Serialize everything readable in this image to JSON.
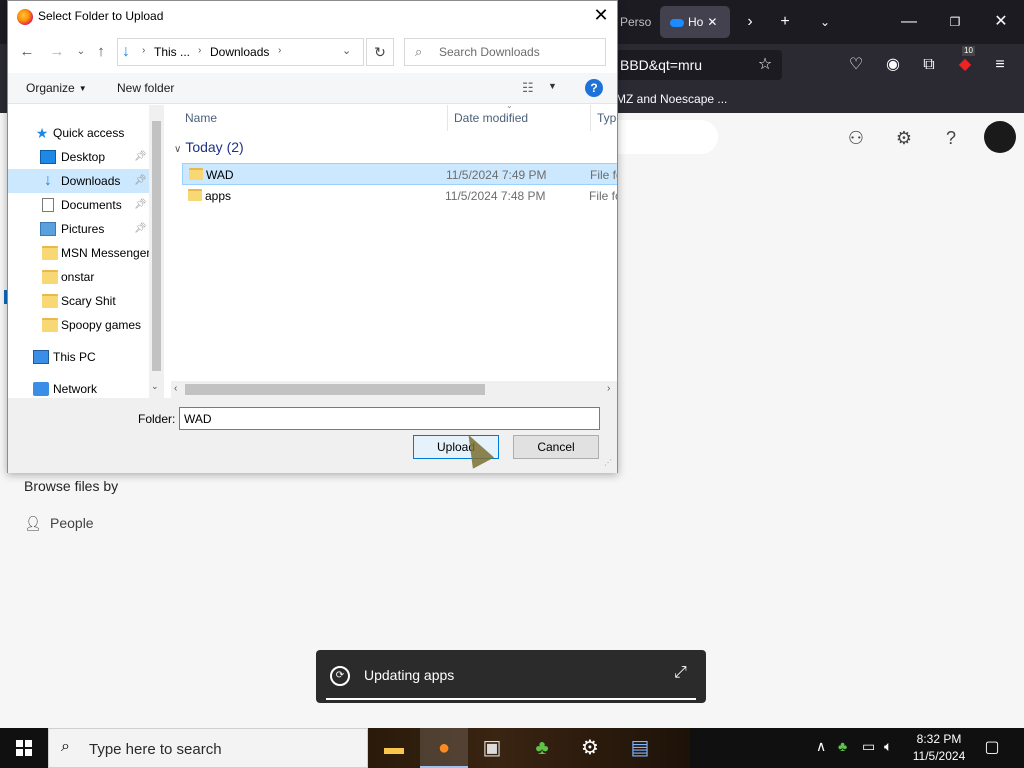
{
  "browser": {
    "tabs": [
      {
        "label": "Perso",
        "active": false
      },
      {
        "label": "Ho",
        "active": true
      }
    ],
    "url_fragment": "BBD&qt=mru",
    "bookmark_label": "MZ and Noescape ...",
    "extension_badge": "10"
  },
  "onedrive": {
    "browse_title": "Browse files by",
    "people_label": "People"
  },
  "dialog": {
    "title": "Select Folder to Upload",
    "close_glyph": "✕",
    "breadcrumb": [
      "This ...",
      "Downloads"
    ],
    "search_placeholder": "Search Downloads",
    "toolbar": {
      "organize": "Organize",
      "new_folder": "New folder"
    },
    "nav_items": [
      {
        "label": "Quick access",
        "icon": "star-icon",
        "pinned": false,
        "selected": false
      },
      {
        "label": "Desktop",
        "icon": "desktop-icon",
        "pinned": true,
        "selected": false
      },
      {
        "label": "Downloads",
        "icon": "download-arrow-icon",
        "pinned": true,
        "selected": true
      },
      {
        "label": "Documents",
        "icon": "document-icon",
        "pinned": true,
        "selected": false
      },
      {
        "label": "Pictures",
        "icon": "pictures-icon",
        "pinned": true,
        "selected": false
      },
      {
        "label": "MSN Messenger",
        "icon": "folder-icon",
        "pinned": false,
        "selected": false
      },
      {
        "label": "onstar",
        "icon": "folder-icon",
        "pinned": false,
        "selected": false
      },
      {
        "label": "Scary Shit",
        "icon": "folder-icon",
        "pinned": false,
        "selected": false
      },
      {
        "label": "Spoopy games",
        "icon": "folder-icon",
        "pinned": false,
        "selected": false
      },
      {
        "label": "This PC",
        "icon": "computer-icon",
        "pinned": false,
        "selected": false
      },
      {
        "label": "Network",
        "icon": "network-icon",
        "pinned": false,
        "selected": false
      }
    ],
    "columns": [
      "Name",
      "Date modified",
      "Type"
    ],
    "group_label": "Today (2)",
    "files": [
      {
        "name": "WAD",
        "date": "11/5/2024 7:49 PM",
        "type": "File fo",
        "selected": true
      },
      {
        "name": "apps",
        "date": "11/5/2024 7:48 PM",
        "type": "File fo",
        "selected": false
      }
    ],
    "folder_label": "Folder:",
    "folder_value": "WAD",
    "upload_label": "Upload",
    "cancel_label": "Cancel"
  },
  "toast": {
    "text": "Updating apps"
  },
  "taskbar": {
    "search_placeholder": "Type here to search",
    "time": "8:32 PM",
    "date": "11/5/2024"
  }
}
